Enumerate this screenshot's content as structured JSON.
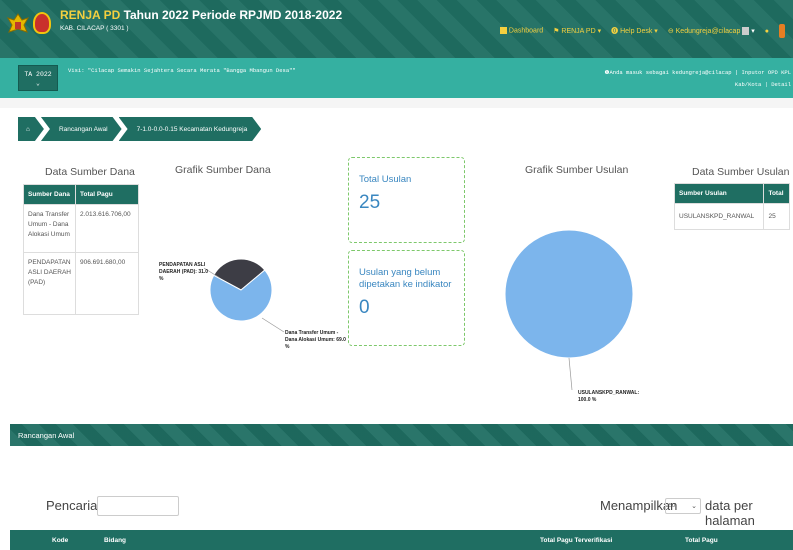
{
  "header": {
    "app_name": "RENJA PD",
    "title_rest": " Tahun 2022 Periode RPJMD 2018-2022",
    "subtitle": "KAB. CILACAP ( 3301 )",
    "nav": [
      {
        "label": "Dashboard",
        "icon": "square-icon"
      },
      {
        "label": "RENJA PD ▾",
        "icon": "flag-icon"
      },
      {
        "label": "Help Desk ▾",
        "icon": "help-icon"
      },
      {
        "label": "Kedungreja@cilacap",
        "icon": "user-icon"
      }
    ]
  },
  "infobar": {
    "year": "TA 2022",
    "year_caret": "⌄",
    "visi": "Visi: \"Cilacap Semakin Sejahtera Secara Merata \"Bangga Mbangun Desa\"\"",
    "login_line1": "Anda masuk sebagai kedungreja@cilacap | Inputor OPD KPL",
    "login_line2": "Kab/Kota | Detail"
  },
  "breadcrumb": {
    "home_icon": "home-icon",
    "items": [
      "Rancangan Awal",
      "7-1.0-0.0-0.15 Kecamatan Kedungreja"
    ]
  },
  "sumber_dana": {
    "title": "Data Sumber Dana",
    "headers": [
      "Sumber Dana",
      "Total Pagu"
    ],
    "rows": [
      [
        "Dana Transfer Umum - Dana Alokasi Umum",
        "2.013.616.706,00"
      ],
      [
        "PENDAPATAN ASLI DAERAH (PAD)",
        "906.691.680,00"
      ]
    ]
  },
  "grafik_dana": {
    "title": "Grafik Sumber Dana",
    "label_pad": "PENDAPATAN ASLI DAERAH (PAD): 31.0 %",
    "label_dau": "Dana Transfer Umum - Dana Alokasi Umum: 69.0 %"
  },
  "cards": [
    {
      "label": "Total Usulan",
      "value": "25"
    },
    {
      "label": "Usulan yang belum dipetakan ke indikator",
      "value": "0"
    }
  ],
  "grafik_usulan": {
    "title": "Grafik Sumber Usulan",
    "label": "USULANSKPD_RANWAL: 100.0 %"
  },
  "sumber_usulan": {
    "title": "Data Sumber Usulan",
    "headers": [
      "Sumber Usulan",
      "Total"
    ],
    "rows": [
      [
        "USULANSKPD_RANWAL",
        "25"
      ]
    ]
  },
  "section": {
    "title": "Rancangan Awal"
  },
  "controls": {
    "search_label": "Pencarian:",
    "show_label": "Menampilkan",
    "show_value": "50",
    "per_page": "data per halaman"
  },
  "table": {
    "headers": [
      "Kode",
      "Bidang",
      "Total Pagu Terverifikasi",
      "Total Pagu"
    ]
  },
  "chart_data": [
    {
      "type": "pie",
      "title": "Grafik Sumber Dana",
      "labels": [
        "PENDAPATAN ASLI DAERAH (PAD)",
        "Dana Transfer Umum - Dana Alokasi Umum"
      ],
      "values": [
        31.0,
        69.0
      ],
      "colors": [
        "#3d3d45",
        "#7cb5ec"
      ]
    },
    {
      "type": "pie",
      "title": "Grafik Sumber Usulan",
      "labels": [
        "USULANSKPD_RANWAL"
      ],
      "values": [
        100.0
      ],
      "colors": [
        "#7cb5ec"
      ]
    }
  ],
  "colors": {
    "primary": "#1f6e62",
    "secondary": "#35b0a1",
    "accent": "#f4d03f",
    "card_border": "#7dc86b"
  }
}
